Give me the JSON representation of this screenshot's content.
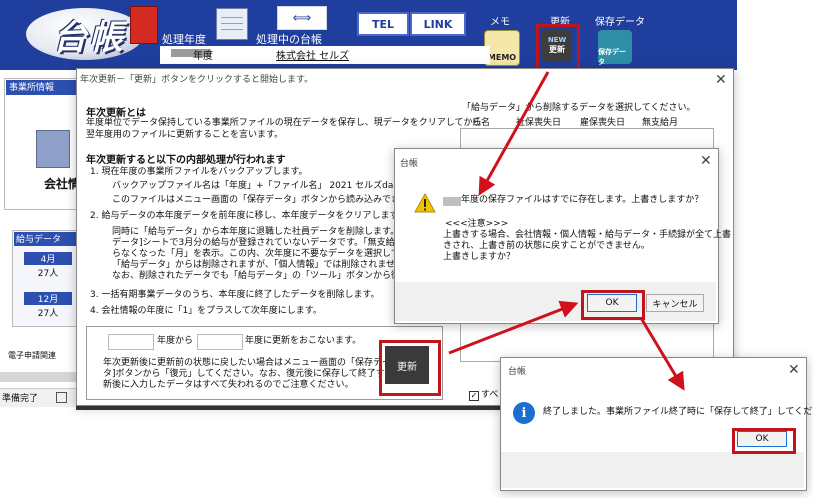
{
  "app_header": {
    "logo_text": "台帳",
    "label_fiscal_year": "処理年度",
    "label_current_ledger": "処理中の台帳",
    "tel_button": "TEL",
    "link_button": "LINK",
    "memo_label": "メモ",
    "update_label": "更新",
    "save_data_label": "保存データ",
    "memo_icon_text": "MEMO",
    "new_icon_text": "NEW",
    "update_icon_text": "更新",
    "save_icon_text": "保存データ",
    "year_suffix": "年度",
    "company_name": "株式会社 セルズ"
  },
  "background": {
    "office_info_tab": "事業所情報",
    "company_info_tab": "会社情",
    "salary_data_tab": "給与データ",
    "month_april": "4月",
    "count_april": "27人",
    "month_december": "12月",
    "count_december": "27人",
    "e_filing_label": "電子申請関連",
    "status_ready": "準備完了"
  },
  "main_dialog": {
    "title": "年次更新－「更新」ボタンをクリックすると開始します。",
    "section1_heading": "年次更新とは",
    "section1_line1": "年度単位でデータ保持している事業所ファイルの現在データを保存し、現データをクリアしてから",
    "section1_line2": "翌年度用のファイルに更新することを言います。",
    "section2_heading": "年次更新すると以下の内部処理が行われます",
    "step1": "1. 現在年度の事業所ファイルをバックアップします。",
    "step1_sub1": "バックアップファイル名は「年度」+「ファイル名」 2021 セルズda.xls  です。",
    "step1_sub2": "このファイルはメニュー画面の「保存データ」ボタンから読み込みできます。",
    "step2": "2. 給与データの本年度データを前年度に移し、本年度データをクリアします。",
    "step2_sub1": "同時に「給与データ」から本年度に退職した社員データを削除します。右のリスト",
    "step2_sub2": "データ]シートで3月分の給与が登録されていないデータです。「無支給月」に該",
    "step2_sub3": "らなくなった「月」を表示。この内、次年度に不要なデータを選択してください。(こ",
    "step2_sub4": "「給与データ」からは削除されますが、「個人情報」では削除されません。",
    "step2_sub5": "なお、削除されたデータでも「給与データ」の「ツール」ボタンから復活が可能です",
    "step3": "3. 一括有期事業データのうち、本年度に終了したデータを削除します。",
    "step4": "4. 会社情報の年度に「1」をプラスして次年度にします。",
    "year_to_label": "年度から",
    "year_update_label": "年度に更新をおこないます。",
    "note_line1": "年次更新後に更新前の状態に戻したい場合はメニュー画面の「保存デー",
    "note_line2": "タ]ボタンから「復元」してください。なお、復元後に保存して終了すると、更",
    "note_line3": "新後に入力したデータはすべて失われるのでご注意ください。",
    "update_button": "更新",
    "right_instruction": "「給与データ」から削除するデータを選択してください。",
    "col_name": "氏名",
    "col_insurance_leave": "社保喪失日",
    "col_employment_leave": "雇保喪失日",
    "col_no_pay_month": "無支給月",
    "select_all_label": "すべ"
  },
  "overwrite_dialog": {
    "title": "台帳",
    "message": "年度の保存ファイルはすでに存在します。上書きしますか？",
    "note_heading": "<<<注意>>>",
    "note_line1": "上書きする場合、会社情報・個人情報・給与データ・手続録が全て上書",
    "note_line2": "きされ、上書き前の状態に戻すことができません。",
    "note_line3": "上書きしますか？",
    "ok_button": "OK",
    "cancel_button": "キャンセル"
  },
  "complete_dialog": {
    "title": "台帳",
    "message": "終了しました。事業所ファイル終了時に「保存して終了」してください。",
    "ok_button": "OK"
  },
  "colors": {
    "header_blue": "#1f3e9e",
    "highlight_red": "#c0151b",
    "info_blue": "#1a6fd1",
    "warning_yellow": "#f2c200"
  },
  "icons": [
    "calendar-icon",
    "swap-icon",
    "memo-icon",
    "new-update-icon",
    "save-data-icon",
    "warning-icon",
    "info-icon",
    "close-icon",
    "building-icon"
  ]
}
